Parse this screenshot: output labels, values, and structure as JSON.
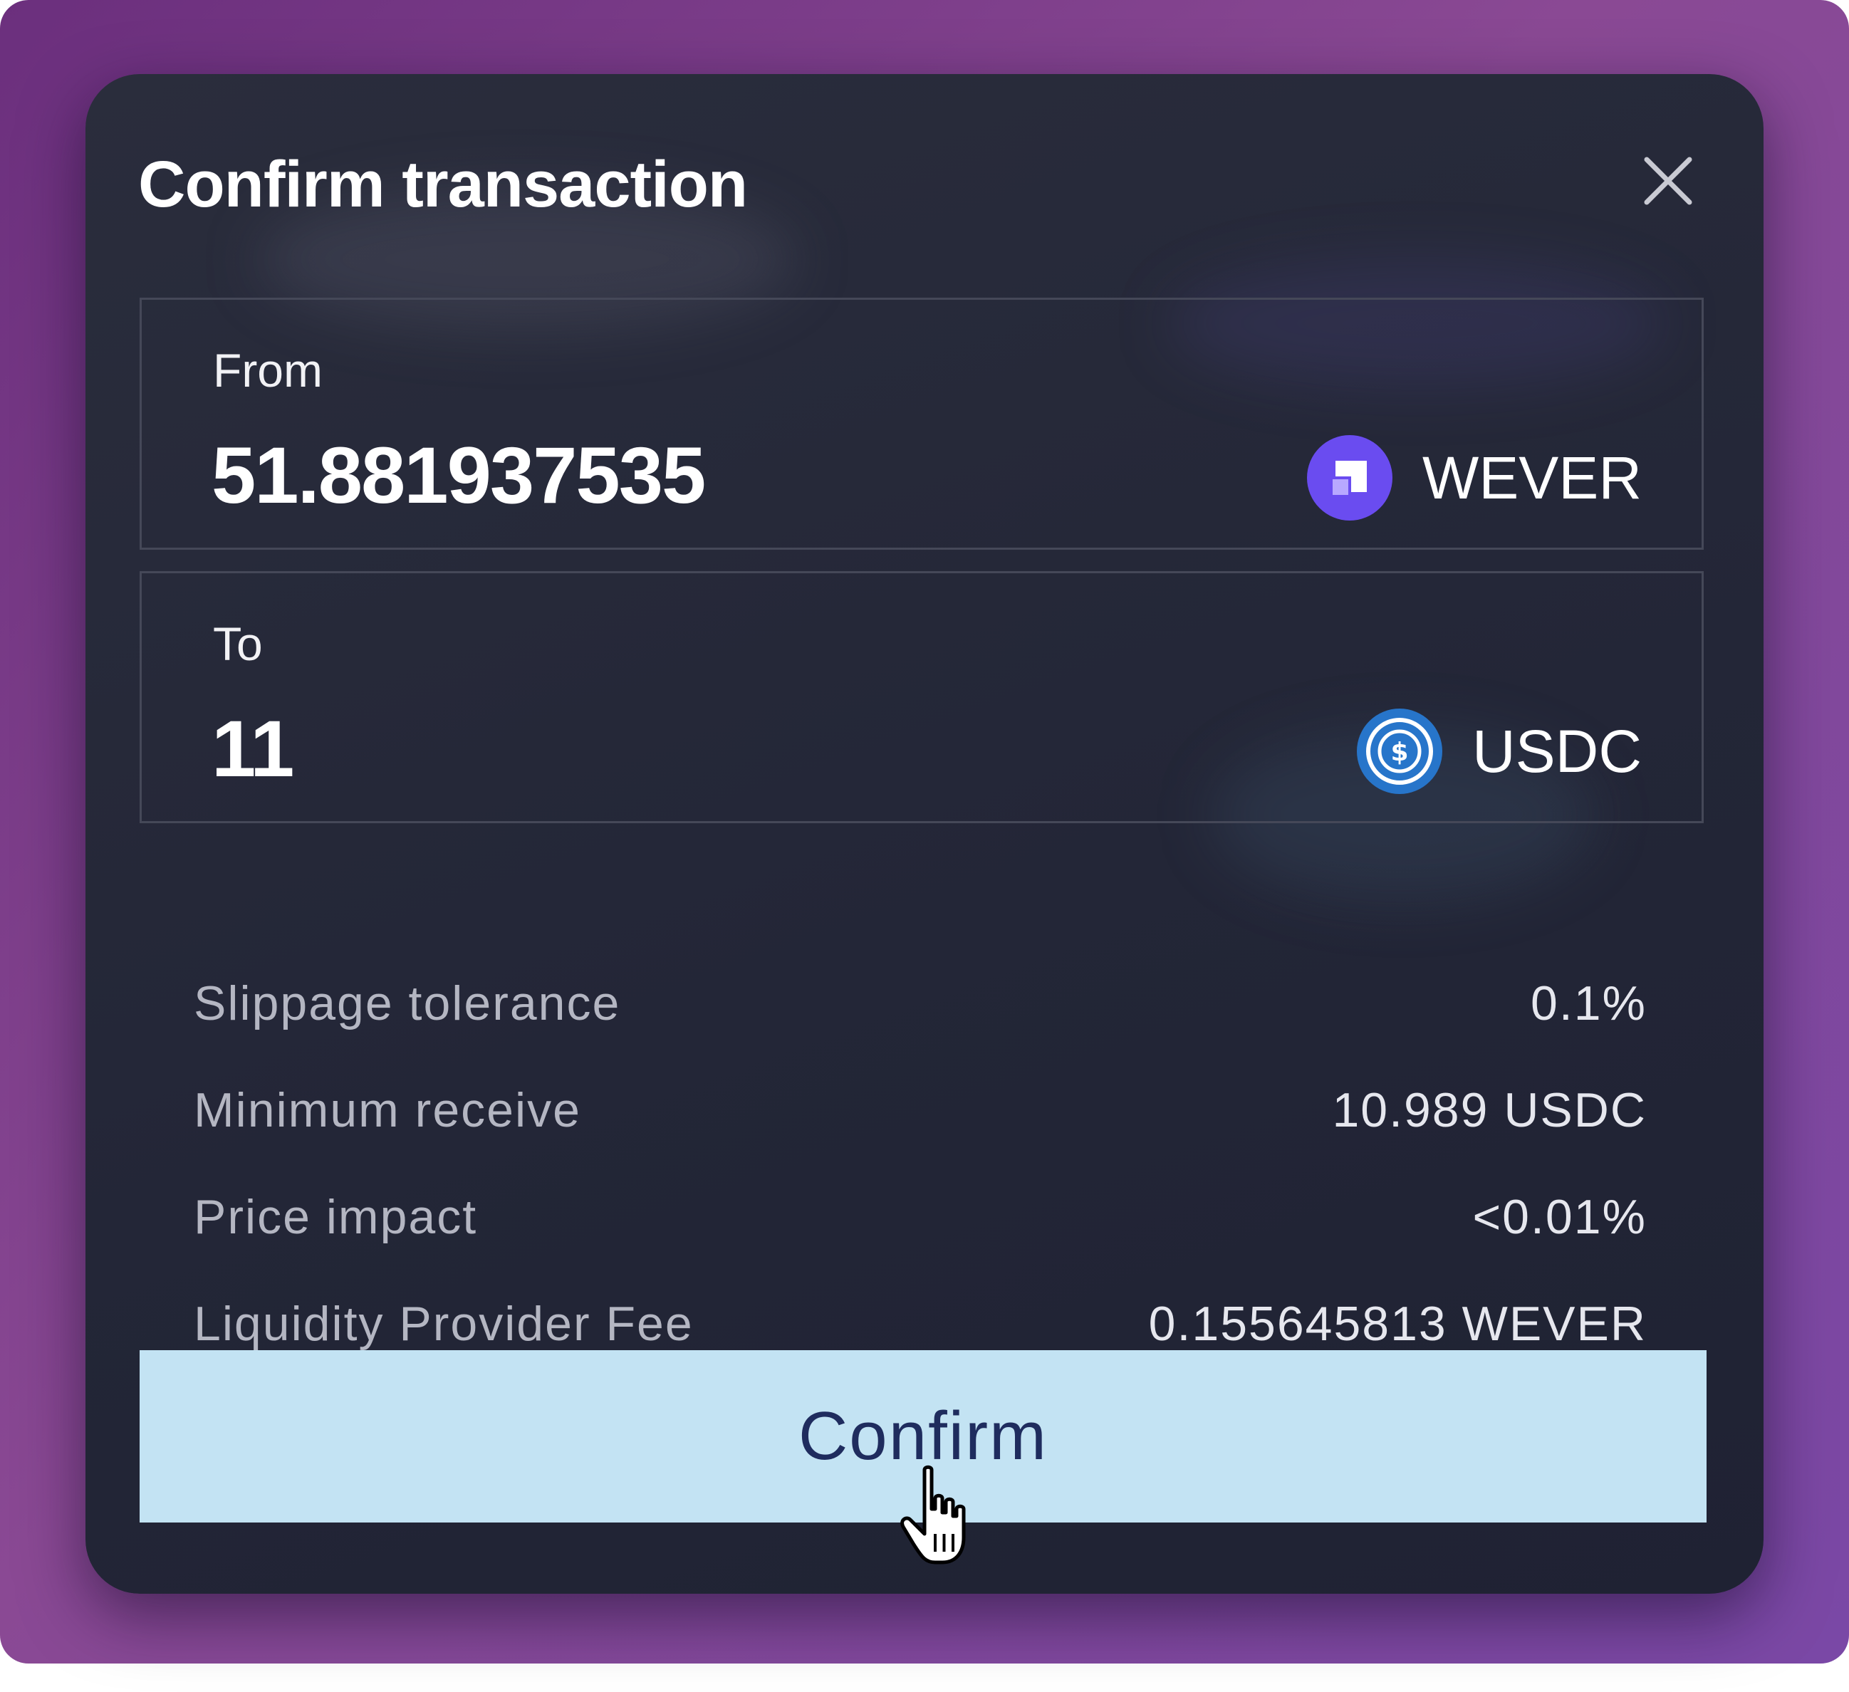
{
  "dialog": {
    "title": "Confirm transaction",
    "close_icon": "close-icon"
  },
  "from": {
    "label": "From",
    "amount": "51.881937535",
    "token": "WEVER",
    "token_icon": "wever-token-icon"
  },
  "to": {
    "label": "To",
    "amount": "11",
    "token": "USDC",
    "token_icon": "usdc-token-icon"
  },
  "details": [
    {
      "label": "Slippage tolerance",
      "value": "0.1%"
    },
    {
      "label": "Minimum receive",
      "value": "10.989 USDC"
    },
    {
      "label": "Price impact",
      "value": "<0.01%"
    },
    {
      "label": "Liquidity Provider Fee",
      "value": "0.155645813 WEVER"
    }
  ],
  "confirm_button": {
    "label": "Confirm"
  },
  "colors": {
    "backdrop": "#7e3f8f",
    "modal": "#252838",
    "confirm_button": "#c3e3f3",
    "confirm_text": "#1f2c5e",
    "wever_icon": "#6a4cf0",
    "usdc_icon": "#2775ca"
  },
  "cursor_icon": "hand-pointer-cursor"
}
